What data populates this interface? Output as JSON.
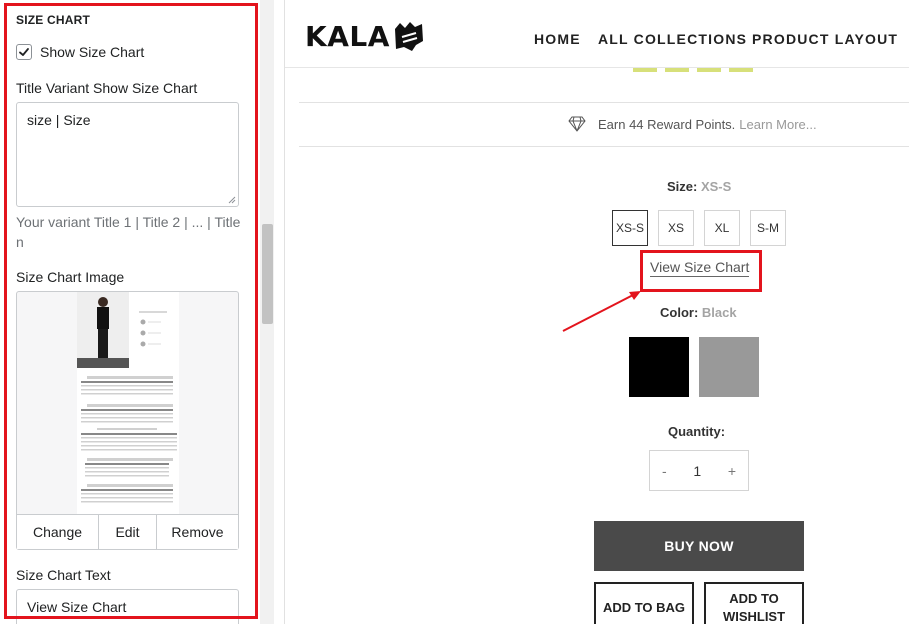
{
  "settings": {
    "section_title": "SIZE CHART",
    "show_checkbox": {
      "label": "Show Size Chart",
      "checked": true
    },
    "title_variant": {
      "label": "Title Variant Show Size Chart",
      "value": "size | Size"
    },
    "help_text": "Your variant Title 1 | Title 2 | ... | Title n",
    "image": {
      "label": "Size Chart Image",
      "actions": {
        "change": "Change",
        "edit": "Edit",
        "remove": "Remove"
      }
    },
    "chart_text": {
      "label": "Size Chart Text",
      "value": "View Size Chart"
    },
    "highlight_color": "#e3141d"
  },
  "store": {
    "logo_text": "KALA",
    "nav": [
      "HOME",
      "ALL COLLECTIONS",
      "PRODUCT LAYOUT"
    ],
    "reward": {
      "text": "Earn 44 Reward Points.",
      "link": "Learn More..."
    },
    "size": {
      "label": "Size:",
      "selected": "XS-S",
      "options": [
        "XS-S",
        "XS",
        "XL",
        "S-M"
      ]
    },
    "view_size_chart": "View Size Chart",
    "color": {
      "label": "Color:",
      "selected": "Black",
      "swatches": [
        "#000000",
        "#999999"
      ]
    },
    "quantity": {
      "label": "Quantity:",
      "minus": "-",
      "value": "1",
      "plus": "+"
    },
    "buy_now": "BUY NOW",
    "add_to_bag": "ADD TO BAG",
    "add_to_wishlist": [
      "ADD TO",
      "WISHLIST"
    ]
  }
}
